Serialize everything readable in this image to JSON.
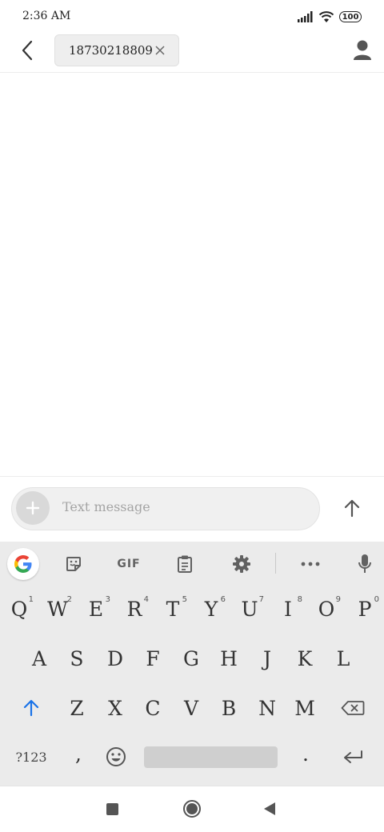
{
  "status_bar": {
    "time": "2:36 AM",
    "battery": "100",
    "icons": [
      "signal-icon",
      "wifi-icon",
      "battery-icon"
    ]
  },
  "header": {
    "back_icon": "chevron-left-icon",
    "recipient": "18730218809",
    "remove_icon": "close-icon",
    "contact_icon": "person-icon"
  },
  "compose": {
    "attach_icon": "plus-icon",
    "placeholder": "Text message",
    "value": "",
    "send_icon": "arrow-up-icon"
  },
  "keyboard": {
    "toolbar": {
      "items": [
        "google-icon",
        "sticker-icon",
        "gif",
        "clipboard-icon",
        "gear-icon",
        "more-icon",
        "mic-icon"
      ],
      "gif_label": "GIF"
    },
    "row1": [
      {
        "key": "Q",
        "hint": "1"
      },
      {
        "key": "W",
        "hint": "2"
      },
      {
        "key": "E",
        "hint": "3"
      },
      {
        "key": "R",
        "hint": "4"
      },
      {
        "key": "T",
        "hint": "5"
      },
      {
        "key": "Y",
        "hint": "6"
      },
      {
        "key": "U",
        "hint": "7"
      },
      {
        "key": "I",
        "hint": "8"
      },
      {
        "key": "O",
        "hint": "9"
      },
      {
        "key": "P",
        "hint": "0"
      }
    ],
    "row2": [
      "A",
      "S",
      "D",
      "F",
      "G",
      "H",
      "J",
      "K",
      "L"
    ],
    "row3": [
      "Z",
      "X",
      "C",
      "V",
      "B",
      "N",
      "M"
    ],
    "row4": {
      "numbers": "?123",
      "comma": ",",
      "period": "."
    },
    "accent_color": "#1a73e8"
  },
  "nav_bar": {
    "icons": [
      "square-recents-icon",
      "circle-home-icon",
      "triangle-back-icon"
    ]
  }
}
